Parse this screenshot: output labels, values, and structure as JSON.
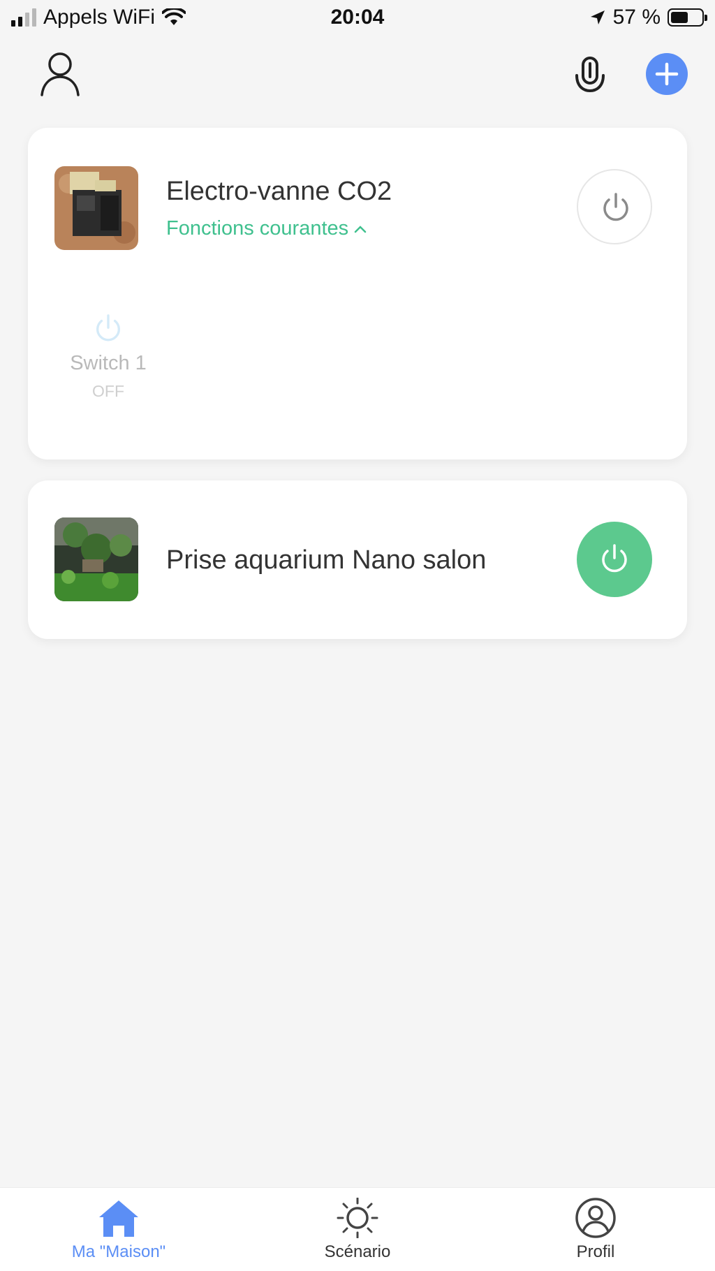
{
  "status_bar": {
    "carrier": "Appels WiFi",
    "time": "20:04",
    "battery_percent": "57 %",
    "battery_level": 0.57
  },
  "header": {
    "profile_icon": "user-icon",
    "voice_icon": "microphone-icon",
    "add_icon": "plus-icon",
    "accent_color": "#5b8ef5"
  },
  "devices": [
    {
      "name": "Electro-vanne CO2",
      "functions_label": "Fonctions courantes",
      "power_state": "off",
      "switches": [
        {
          "label": "Switch 1",
          "state": "OFF"
        }
      ]
    },
    {
      "name": "Prise aquarium Nano salon",
      "power_state": "on",
      "on_color": "#5cc98e"
    }
  ],
  "tab_bar": {
    "tabs": [
      {
        "label": "Ma \"Maison\"",
        "icon": "home-icon",
        "active": true
      },
      {
        "label": "Scénario",
        "icon": "sun-icon",
        "active": false
      },
      {
        "label": "Profil",
        "icon": "profile-circle-icon",
        "active": false
      }
    ]
  }
}
